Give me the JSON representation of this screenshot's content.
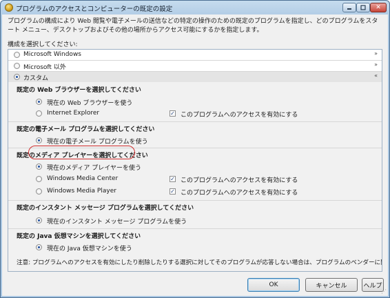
{
  "window": {
    "title": "プログラムのアクセスとコンピューターの既定の設定",
    "close_glyph": "✕"
  },
  "description": "プログラムの構成により Web 閲覧や電子メールの送信などの特定の操作のための既定のプログラムを指定し、どのプログラムをスタート メニュー、デスクトップおよびその他の場所からアクセス可能にするかを指定します。",
  "select_label": "構成を選択してください:",
  "configs": [
    {
      "label": "Microsoft Windows",
      "selected": false,
      "chevron": "»",
      "expanded": false
    },
    {
      "label": "Microsoft 以外",
      "selected": false,
      "chevron": "»",
      "expanded": false
    },
    {
      "label": "カスタム",
      "selected": true,
      "chevron": "«",
      "expanded": true
    }
  ],
  "sections": {
    "browser": {
      "title": "既定の Web ブラウザーを選択してください",
      "options": [
        {
          "label": "現在の Web ブラウザーを使う",
          "selected": true
        },
        {
          "label": "Internet Explorer",
          "selected": false,
          "access_label": "このプログラムへのアクセスを有効にする",
          "access_checked": true
        }
      ]
    },
    "email": {
      "title": "既定の電子メール プログラムを選択してください",
      "options": [
        {
          "label": "現在の電子メール プログラムを使う",
          "selected": true
        }
      ]
    },
    "media": {
      "title": "既定のメディア プレイヤーを選択してください",
      "options": [
        {
          "label": "現在のメディア プレイヤーを使う",
          "selected": true
        },
        {
          "label": "Windows Media Center",
          "selected": false,
          "access_label": "このプログラムへのアクセスを有効にする",
          "access_checked": true
        },
        {
          "label": "Windows Media Player",
          "selected": false,
          "access_label": "このプログラムへのアクセスを有効にする",
          "access_checked": true
        }
      ]
    },
    "im": {
      "title": "既定のインスタント メッセージ プログラムを選択してください",
      "options": [
        {
          "label": "現在のインスタント メッセージ プログラムを使う",
          "selected": true
        }
      ]
    },
    "java": {
      "title": "既定の Java 仮想マシンを選択してください",
      "options": [
        {
          "label": "現在の Java 仮想マシンを使う",
          "selected": true
        }
      ]
    }
  },
  "note": "注意: プログラムへのアクセスを有効にしたり削除したりする選択に対してそのプログラムが応答しない場合は、プログラムのベンダーに問い合わせてください。",
  "buttons": {
    "ok": "OK",
    "cancel": "キャンセル",
    "help": "ヘルプ"
  },
  "colors": {
    "highlight_ring": "#d12e2e",
    "title_bar": "#a9c6e2"
  }
}
